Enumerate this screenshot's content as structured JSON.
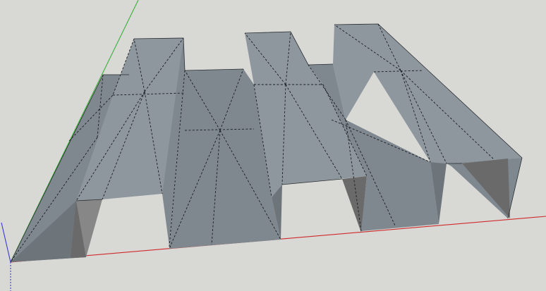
{
  "viewport": {
    "background_color": "#d8d8d5"
  },
  "axes": {
    "x_axis_color": "#cf2a2a",
    "y_axis_color": "#3bb03b",
    "z_axis_color": "#3a3ad0"
  },
  "model": {
    "name": "",
    "face_colors": {
      "light": "#8e979e",
      "mid": "#7f888f",
      "dark": "#6d757b",
      "cutout": "#878787",
      "cutout_shadow": "#6a6a6a"
    },
    "edge_color": "#1b1e21"
  }
}
